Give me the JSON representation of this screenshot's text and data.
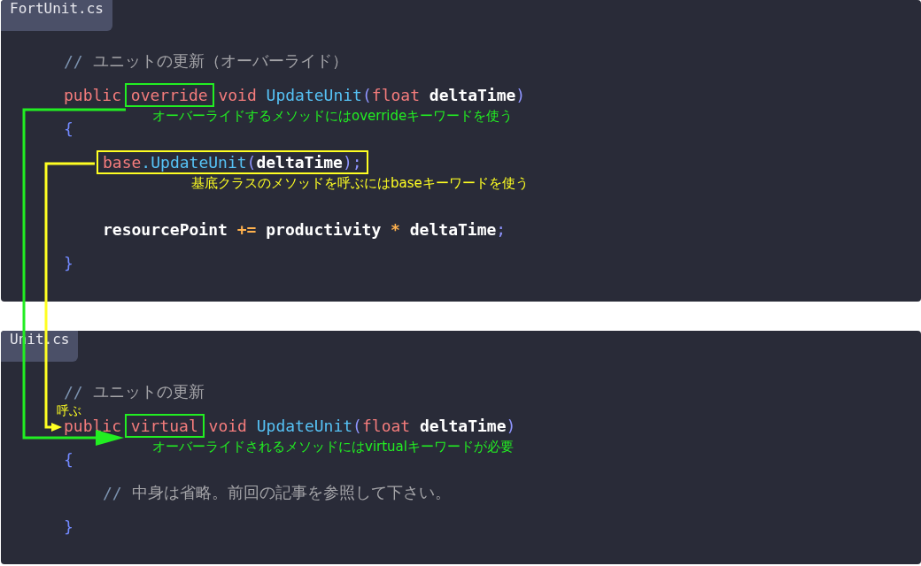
{
  "panels": [
    {
      "filename": "FortUnit.cs",
      "lines": [
        {
          "kind": "code",
          "words": [
            {
              "tokens": [
                {
                  "kind": "comment_marker",
                  "text": "//"
                }
              ]
            },
            {
              "tokens": [
                {
                  "kind": "comment",
                  "text": "ユニットの更新（オーバーライド）"
                }
              ]
            }
          ]
        },
        {
          "kind": "code",
          "words": [
            {
              "tokens": [
                {
                  "kind": "keyword",
                  "text": "public"
                }
              ]
            },
            {
              "color": "#22ee22",
              "tokens": [
                {
                  "kind": "keyword",
                  "text": "override"
                }
              ]
            },
            {
              "tokens": [
                {
                  "kind": "keyword",
                  "text": "void"
                }
              ]
            },
            {
              "tokens": [
                {
                  "kind": "function",
                  "text": "UpdateUnit"
                },
                {
                  "kind": "punct",
                  "text": "("
                },
                {
                  "kind": "keyword",
                  "text": "float"
                }
              ]
            },
            {
              "tokens": [
                {
                  "kind": "ident",
                  "text": "deltaTime"
                },
                {
                  "kind": "punct",
                  "text": ")"
                }
              ]
            }
          ],
          "note": {
            "text": "オーバーライドするメソッドにはoverrideキーワードを使う",
            "color": "#22ee22"
          }
        },
        {
          "kind": "code",
          "words": [
            {
              "tokens": [
                {
                  "kind": "brace",
                  "text": "{"
                }
              ]
            }
          ]
        },
        {
          "kind": "body",
          "children": [
            {
              "kind": "code",
              "words": [
                {
                  "color": "#ffff22",
                  "tokens": [
                    {
                      "kind": "keyword",
                      "text": "base"
                    },
                    {
                      "kind": "dot",
                      "text": "."
                    },
                    {
                      "kind": "function",
                      "text": "UpdateUnit"
                    },
                    {
                      "kind": "punct",
                      "text": "("
                    },
                    {
                      "kind": "ident",
                      "text": "deltaTime"
                    },
                    {
                      "kind": "punct",
                      "text": ")"
                    },
                    {
                      "kind": "punct",
                      "text": ";"
                    }
                  ]
                }
              ],
              "note": {
                "text": "基底クラスのメソッドを呼ぶにはbaseキーワードを使う",
                "color": "#ffff22"
              }
            },
            {
              "kind": "blank"
            },
            {
              "kind": "code",
              "words": [
                {
                  "tokens": [
                    {
                      "kind": "ident",
                      "text": "resourcePoint"
                    }
                  ]
                },
                {
                  "tokens": [
                    {
                      "kind": "operator",
                      "text": "+="
                    }
                  ]
                },
                {
                  "tokens": [
                    {
                      "kind": "ident",
                      "text": "productivity"
                    }
                  ]
                },
                {
                  "tokens": [
                    {
                      "kind": "operator",
                      "text": "*"
                    }
                  ]
                },
                {
                  "tokens": [
                    {
                      "kind": "ident",
                      "text": "deltaTime"
                    },
                    {
                      "kind": "punct",
                      "text": ";"
                    }
                  ]
                }
              ]
            }
          ]
        },
        {
          "kind": "code",
          "words": [
            {
              "tokens": [
                {
                  "kind": "brace",
                  "text": "}"
                }
              ]
            }
          ]
        }
      ]
    },
    {
      "filename": "Unit.cs",
      "lines": [
        {
          "kind": "code",
          "words": [
            {
              "tokens": [
                {
                  "kind": "comment_marker",
                  "text": "//"
                }
              ]
            },
            {
              "tokens": [
                {
                  "kind": "comment",
                  "text": "ユニットの更新"
                }
              ]
            }
          ]
        },
        {
          "kind": "code",
          "words": [
            {
              "tokens": [
                {
                  "kind": "keyword",
                  "text": "public"
                }
              ]
            },
            {
              "color": "#22ee22",
              "tokens": [
                {
                  "kind": "keyword",
                  "text": "virtual"
                }
              ]
            },
            {
              "tokens": [
                {
                  "kind": "keyword",
                  "text": "void"
                }
              ]
            },
            {
              "tokens": [
                {
                  "kind": "function",
                  "text": "UpdateUnit"
                },
                {
                  "kind": "punct",
                  "text": "("
                },
                {
                  "kind": "keyword",
                  "text": "float"
                }
              ]
            },
            {
              "tokens": [
                {
                  "kind": "ident",
                  "text": "deltaTime"
                },
                {
                  "kind": "punct",
                  "text": ")"
                }
              ]
            }
          ],
          "note": {
            "text": "オーバーライドされるメソッドにはvirtualキーワードが必要",
            "color": "#22ee22"
          }
        },
        {
          "kind": "code",
          "words": [
            {
              "tokens": [
                {
                  "kind": "brace",
                  "text": "{"
                }
              ]
            }
          ]
        },
        {
          "kind": "body",
          "children": [
            {
              "kind": "code",
              "words": [
                {
                  "tokens": [
                    {
                      "kind": "comment_marker",
                      "text": "//"
                    }
                  ]
                },
                {
                  "tokens": [
                    {
                      "kind": "comment",
                      "text": "中身は省略。前回の記事を参照して下さい。"
                    }
                  ]
                }
              ]
            }
          ]
        },
        {
          "kind": "code",
          "words": [
            {
              "tokens": [
                {
                  "kind": "brace",
                  "text": "}"
                }
              ]
            }
          ]
        }
      ]
    }
  ],
  "arrows": [
    {
      "kind": "override_link",
      "color": "#22ee22"
    },
    {
      "kind": "base_call",
      "color": "#ffff22",
      "label": "呼ぶ"
    }
  ]
}
